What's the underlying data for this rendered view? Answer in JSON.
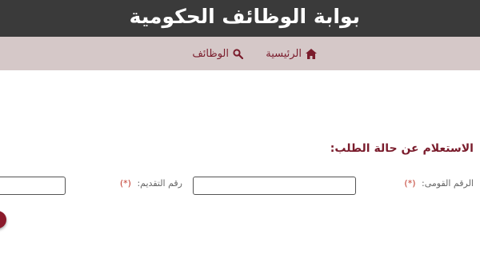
{
  "header": {
    "title": "بوابة الوظائف الحكومية"
  },
  "nav": {
    "home_label": "الرئيسية",
    "jobs_label": "الوظائف",
    "home_icon": "home-icon",
    "jobs_icon": "search-icon"
  },
  "form": {
    "section_title": "الاستعلام عن حالة الطلب:",
    "national_id_label": "الرقم القومى:",
    "application_number_label": "رقم التقديم:",
    "required_marker": "(*)",
    "national_id_value": "",
    "application_number_value": ""
  },
  "colors": {
    "header_bg": "#3a3a3a",
    "nav_bg": "#d5c8c8",
    "accent": "#7a1c2c"
  }
}
